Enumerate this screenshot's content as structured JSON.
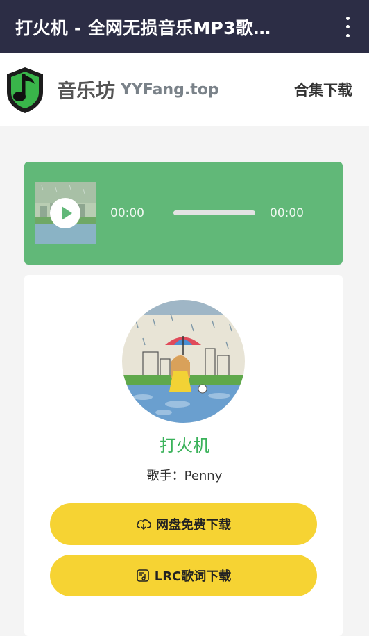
{
  "appbar": {
    "title": "打火机 - 全网无损音乐MP3歌…",
    "menu_icon": "more-vert-icon"
  },
  "header": {
    "brand_cn": "音乐坊",
    "brand_en": "YYFang.top",
    "nav_link": "合集下载",
    "logo_icon": "music-note-shield-icon"
  },
  "player": {
    "current_time": "00:00",
    "duration": "00:00",
    "progress": 0,
    "play_icon": "play-icon"
  },
  "song": {
    "title": "打火机",
    "artist": "歌手：Penny"
  },
  "buttons": {
    "cloud_download": "网盘免费下载",
    "cloud_icon": "cloud-download-icon",
    "lrc_download": "LRC歌词下载",
    "lrc_icon": "lyrics-file-icon"
  },
  "colors": {
    "appbar": "#2c2d45",
    "player": "#61b878",
    "title_green": "#3ab25a",
    "button_yellow": "#f6d333"
  }
}
